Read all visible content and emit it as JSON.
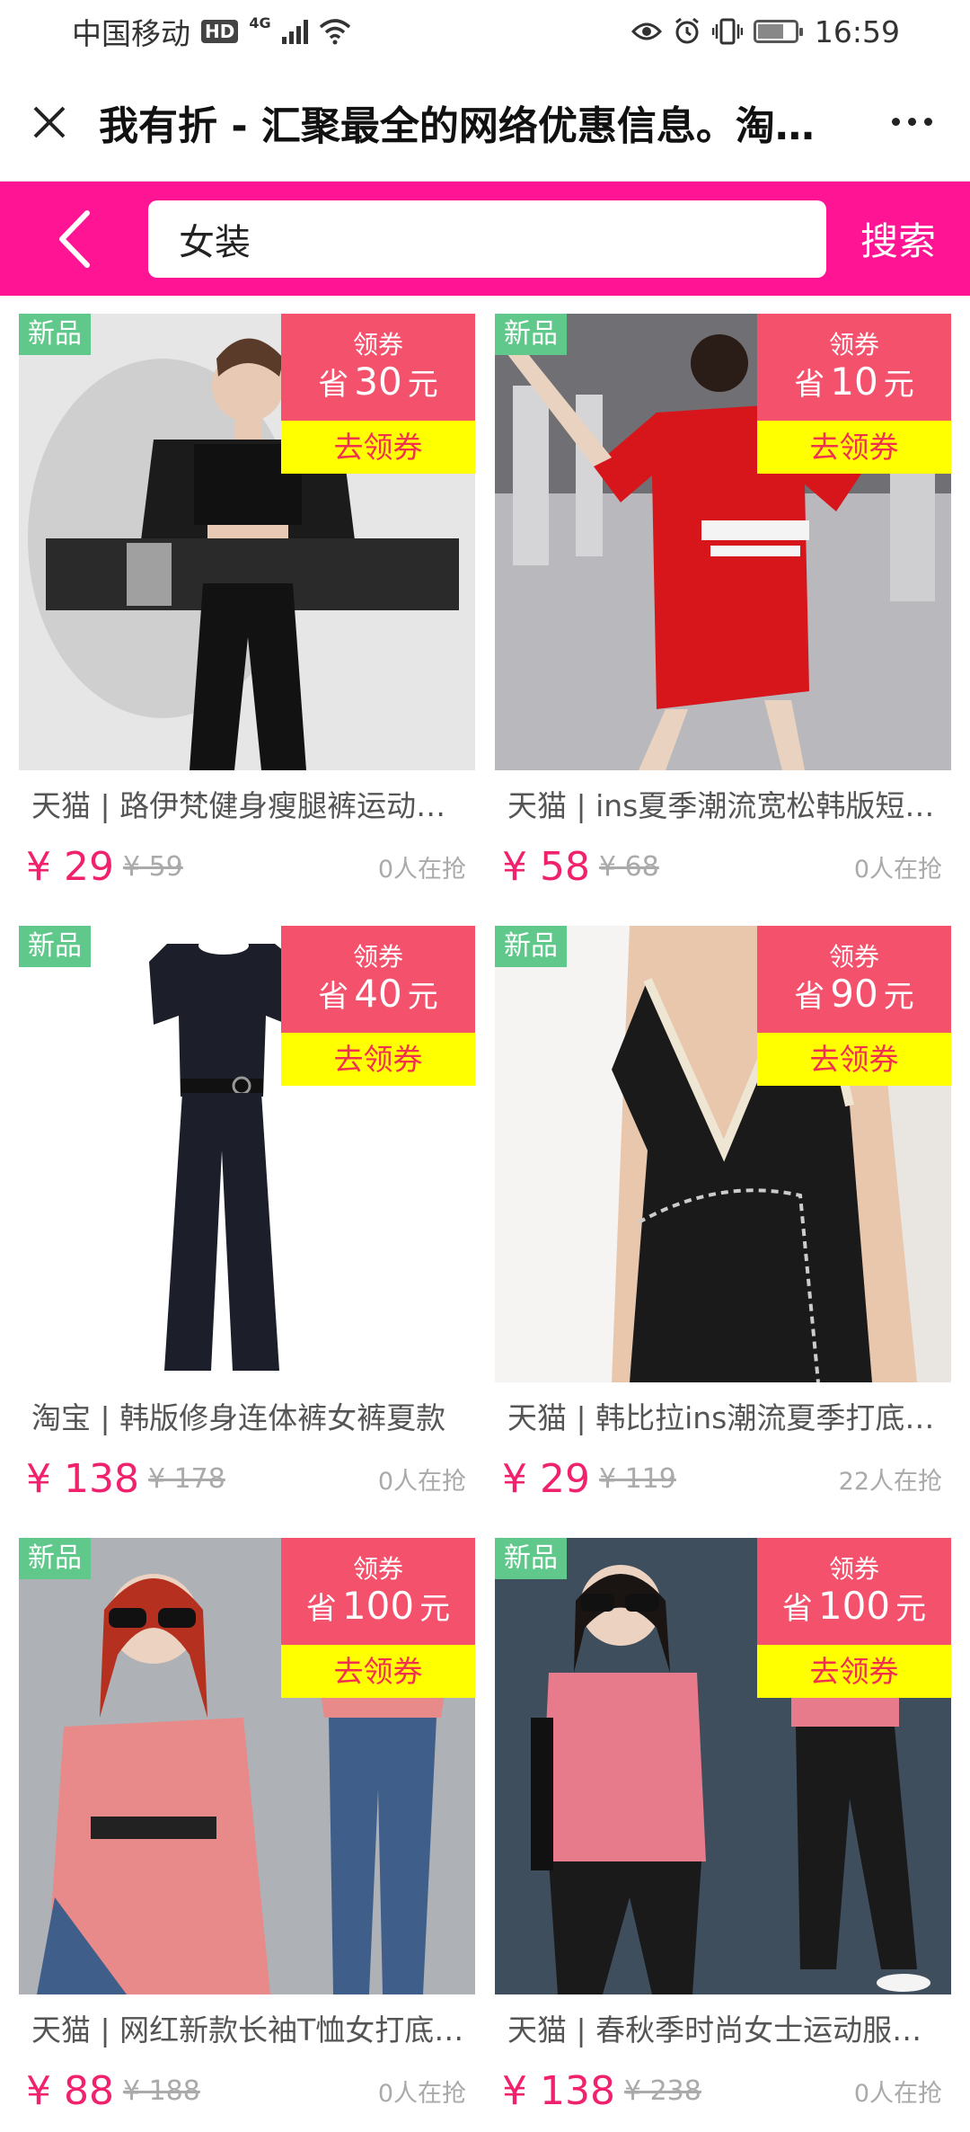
{
  "status_bar": {
    "carrier": "中国移动",
    "hd": "HD",
    "network": "4G",
    "time": "16:59"
  },
  "title_bar": {
    "title": "我有折 - 汇聚最全的网络优惠信息。淘宝天猫优惠券"
  },
  "search": {
    "query": "女装",
    "button_label": "搜索"
  },
  "common": {
    "new_badge": "新品",
    "coupon_label": "领券",
    "coupon_prefix": "省",
    "coupon_suffix": "元",
    "coupon_button": "去领券"
  },
  "products": [
    {
      "title": "天猫 | 路伊梵健身瘦腿裤运动套装女",
      "price": "¥ 29",
      "original_price": "¥ 59",
      "grabbing": "0人在抢",
      "coupon_amount": "30"
    },
    {
      "title": "天猫 | ins夏季潮流宽松韩版短袖连衣裙",
      "price": "¥ 58",
      "original_price": "¥ 68",
      "grabbing": "0人在抢",
      "coupon_amount": "10"
    },
    {
      "title": "淘宝 | 韩版修身连体裤女裤夏款",
      "price": "¥ 138",
      "original_price": "¥ 178",
      "grabbing": "0人在抢",
      "coupon_amount": "40"
    },
    {
      "title": "天猫 | 韩比拉ins潮流夏季打底背心女",
      "price": "¥ 29",
      "original_price": "¥ 119",
      "grabbing": "22人在抢",
      "coupon_amount": "90"
    },
    {
      "title": "天猫 | 网红新款长袖T恤女打底衫春秋",
      "price": "¥ 88",
      "original_price": "¥ 188",
      "grabbing": "0人在抢",
      "coupon_amount": "100"
    },
    {
      "title": "天猫 | 春秋季时尚女士运动服套装女",
      "price": "¥ 138",
      "original_price": "¥ 238",
      "grabbing": "0人在抢",
      "coupon_amount": "100"
    }
  ]
}
